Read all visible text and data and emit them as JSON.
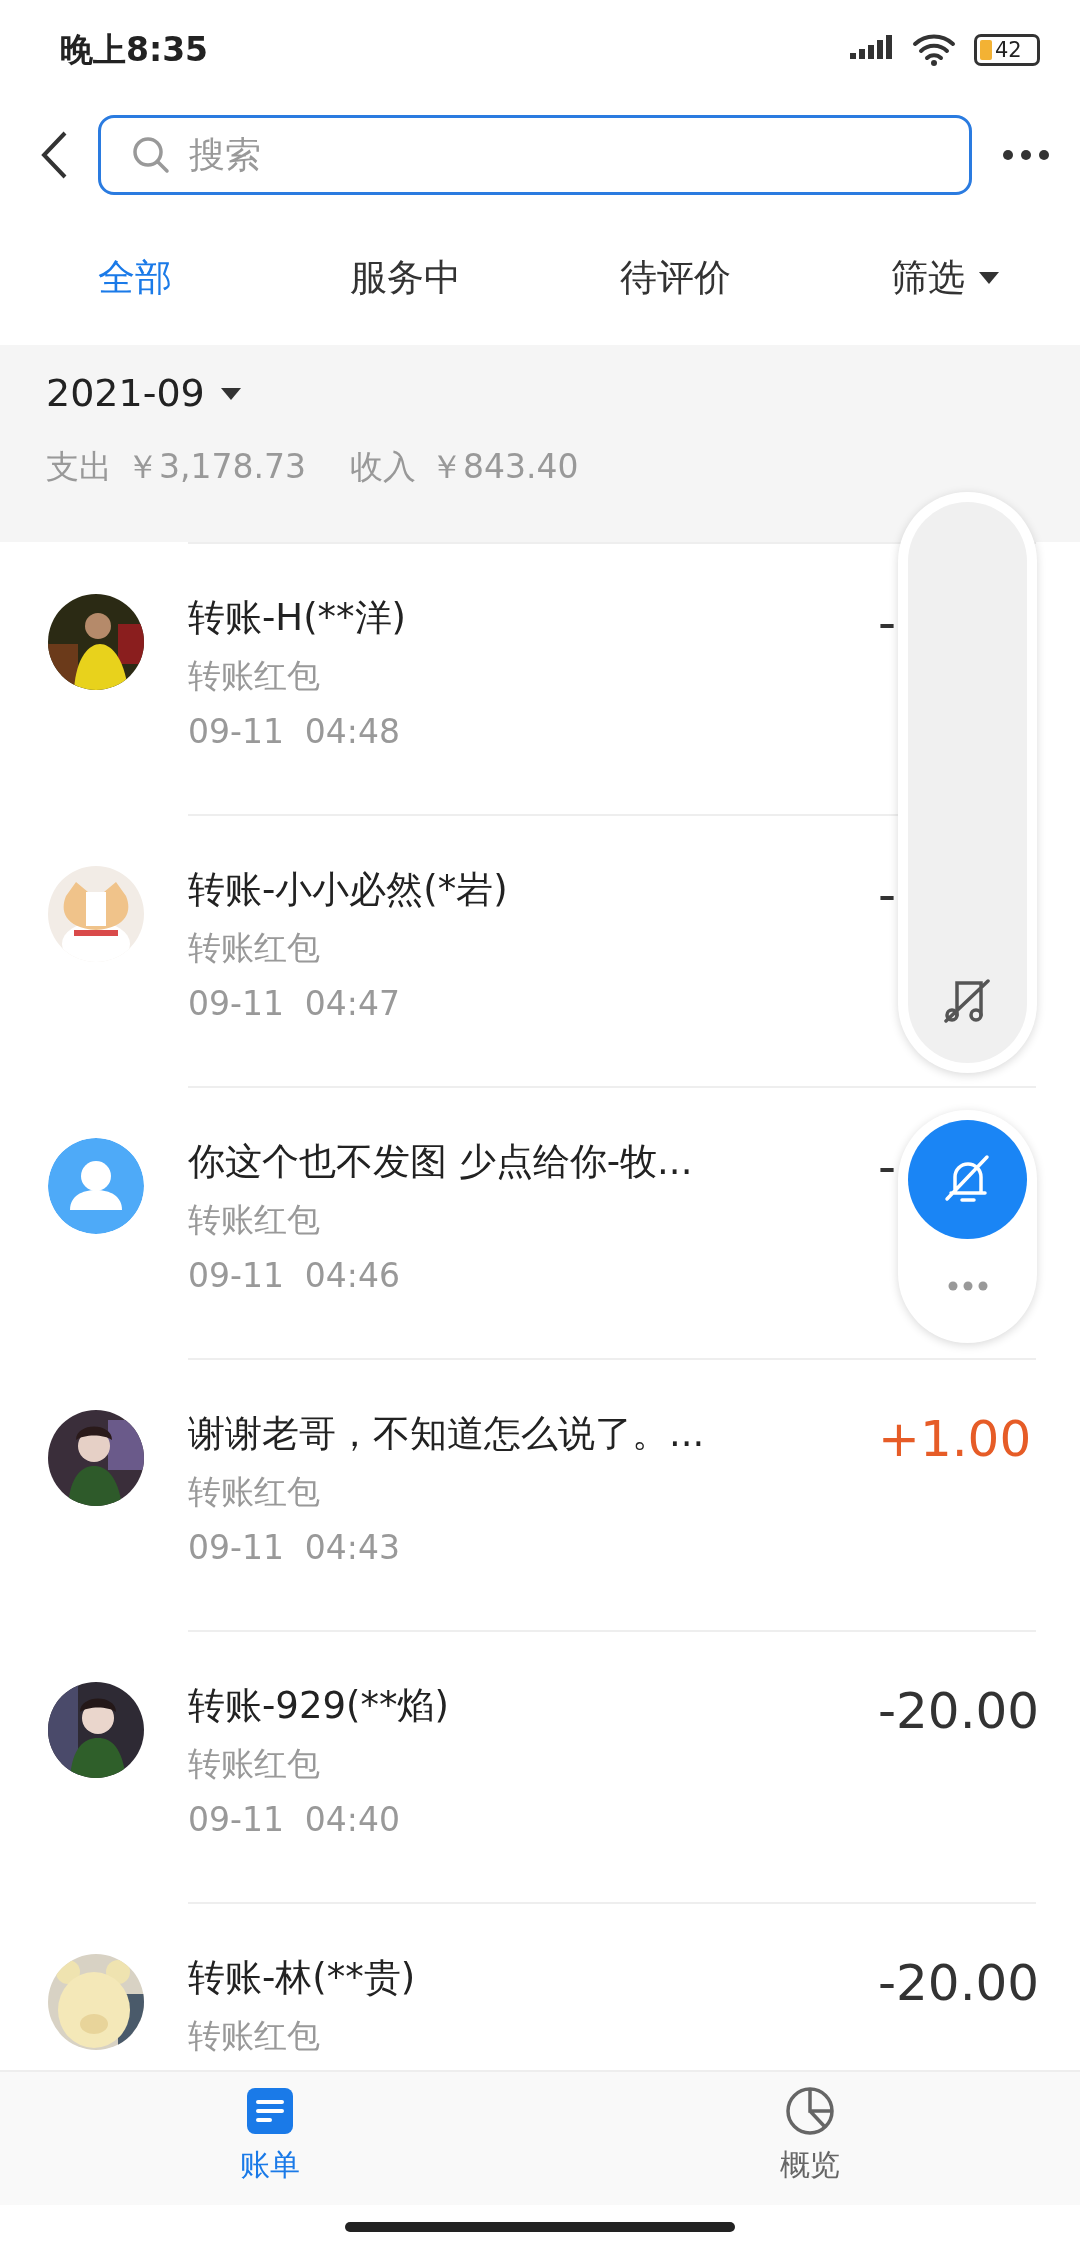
{
  "status_bar": {
    "time": "晚上8:35",
    "battery": "42"
  },
  "search": {
    "placeholder": "搜索"
  },
  "tabs": [
    {
      "label": "全部",
      "selected": true
    },
    {
      "label": "服务中",
      "selected": false
    },
    {
      "label": "待评价",
      "selected": false
    }
  ],
  "filter": {
    "label": "筛选"
  },
  "summary": {
    "month": "2021-09",
    "expense_label": "支出",
    "expense": "￥3,178.73",
    "income_label": "收入",
    "income": "￥843.40"
  },
  "records": [
    {
      "title": "转账-H(**洋)",
      "subtitle": "转账红包",
      "time": "09-11  04:48",
      "amount": "-",
      "kind": "expense"
    },
    {
      "title": "转账-小小必然(*岩)",
      "subtitle": "转账红包",
      "time": "09-11  04:47",
      "amount": "-",
      "kind": "expense"
    },
    {
      "avatar": {
        "kind": "default"
      },
      "title": "你这个也不发图 少点给你-牧...",
      "subtitle": "转账红包",
      "time": "09-11  04:46",
      "amount": "-",
      "kind": "expense"
    },
    {
      "title": "谢谢老哥，不知道怎么说了。...",
      "subtitle": "转账红包",
      "time": "09-11  04:43",
      "amount": "+1.00",
      "kind": "income"
    },
    {
      "title": "转账-929(**焰)",
      "subtitle": "转账红包",
      "time": "09-11  04:40",
      "amount": "-20.00",
      "kind": "expense"
    },
    {
      "title": "转账-林(**贵)",
      "subtitle": "转账红包",
      "amount": "-20.00",
      "kind": "expense"
    }
  ],
  "bottom_tabs": [
    {
      "label": "账单",
      "selected": true,
      "kind": "bill"
    },
    {
      "label": "概览",
      "selected": false,
      "kind": "overview"
    }
  ]
}
